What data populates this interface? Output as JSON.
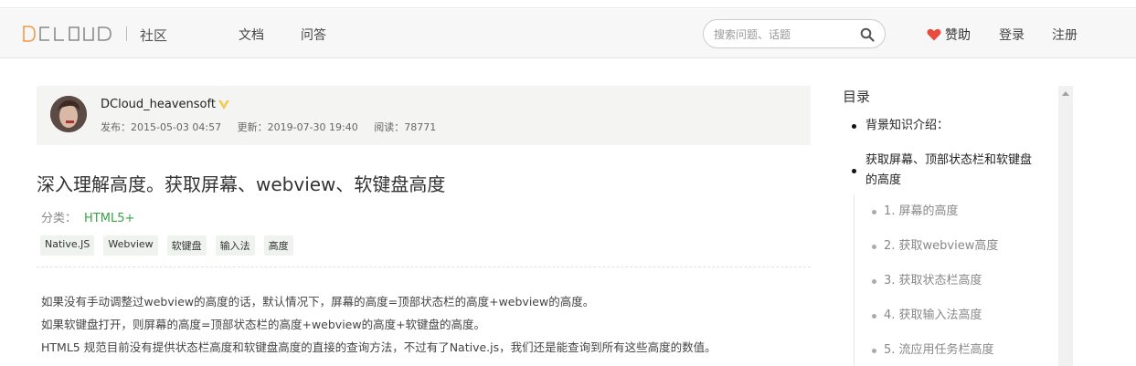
{
  "header": {
    "logo_text": "DCLOUD",
    "community": "社区",
    "nav": [
      "文档",
      "问答"
    ],
    "search_placeholder": "搜索问题、话题",
    "sponsor": "赞助",
    "login": "登录",
    "register": "注册",
    "heart_color": "#e74c3c"
  },
  "author": {
    "name": "DCloud_heavensoft",
    "published": "发布：2015-05-03 04:57",
    "updated": "更新：2019-07-30 19:40",
    "reads": "阅读：78771"
  },
  "article": {
    "title": "深入理解高度。获取屏幕、webview、软键盘高度",
    "category_label": "分类：",
    "category": "HTML5+",
    "tags": [
      "Native.JS",
      "Webview",
      "软键盘",
      "输入法",
      "高度"
    ],
    "paragraphs": [
      "如果没有手动调整过webview的高度的话，默认情况下，屏幕的高度=顶部状态栏的高度+webview的高度。",
      "如果软键盘打开，则屏幕的高度=顶部状态栏的高度+webview的高度+软键盘的高度。",
      "HTML5 规范目前没有提供状态栏高度和软键盘高度的直接的查询方法，不过有了Native.js，我们还是能查询到所有这些高度的数值。"
    ]
  },
  "toc": {
    "title": "目录",
    "item1": "背景知识介绍：",
    "item2a": "获取屏幕、顶部状态栏和软键盘",
    "item2b": "的高度",
    "sub": [
      "1. 屏幕的高度",
      "2. 获取webview高度",
      "3. 获取状态栏高度",
      "4. 获取输入法高度",
      "5. 流应用任务栏高度"
    ]
  }
}
